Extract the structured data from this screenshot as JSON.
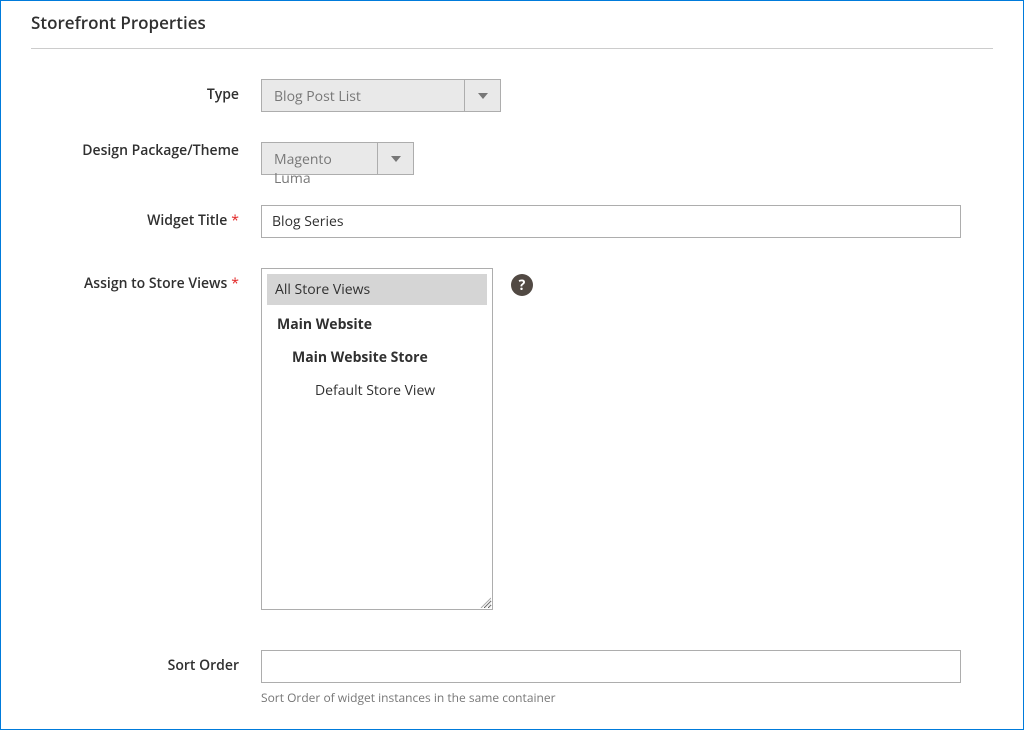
{
  "section": {
    "title": "Storefront Properties"
  },
  "fields": {
    "type": {
      "label": "Type",
      "value": "Blog Post List"
    },
    "theme": {
      "label": "Design Package/Theme",
      "value": "Magento Luma"
    },
    "widgetTitle": {
      "label": "Widget Title",
      "value": "Blog Series",
      "required": "*"
    },
    "storeViews": {
      "label": "Assign to Store Views",
      "required": "*",
      "help": "?",
      "options": {
        "all": "All Store Views",
        "website": "Main Website",
        "store": "Main Website Store",
        "view": "Default Store View"
      }
    },
    "sortOrder": {
      "label": "Sort Order",
      "value": "",
      "hint": "Sort Order of widget instances in the same container"
    }
  }
}
